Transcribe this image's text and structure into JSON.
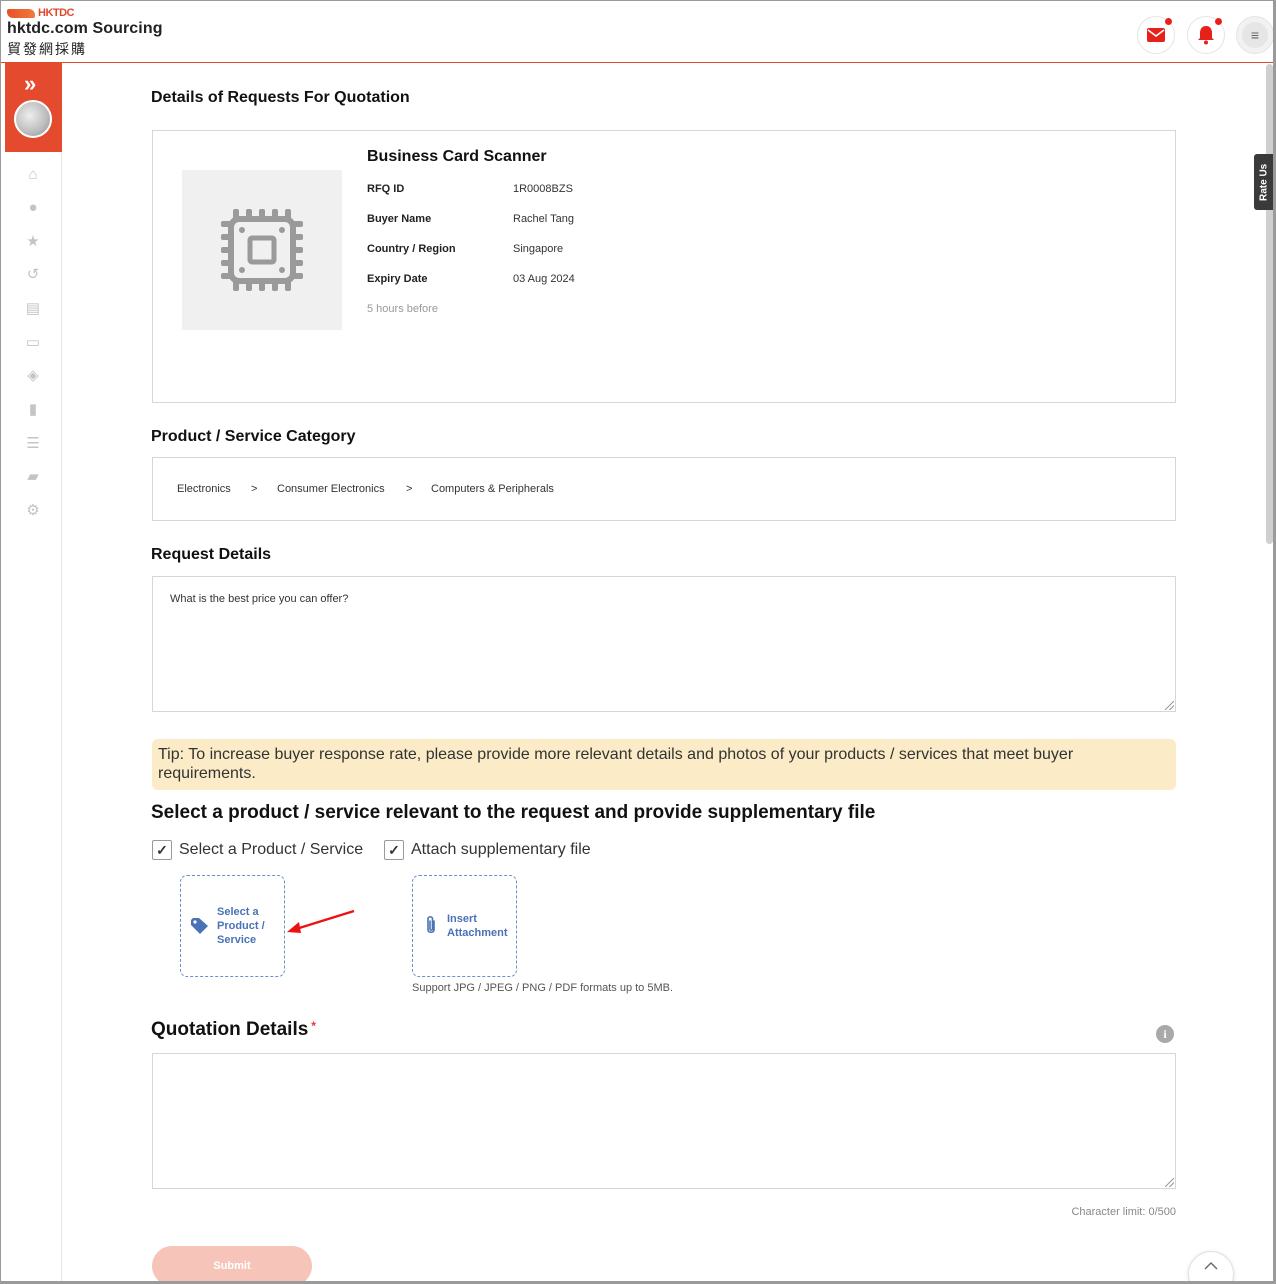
{
  "brand": {
    "small": "HKTDC",
    "main": "hktdc.com Sourcing",
    "zh": "貿發網採購",
    "accent": "#e44a2e"
  },
  "header": {
    "icons": [
      "mail-icon",
      "bell-icon",
      "menu-icon"
    ]
  },
  "sidebar": {
    "expand_glyph": "»",
    "items": [
      {
        "name": "home-icon",
        "glyph": "⌂"
      },
      {
        "name": "user-icon",
        "glyph": "●"
      },
      {
        "name": "star-icon",
        "glyph": "★"
      },
      {
        "name": "history-icon",
        "glyph": "↺"
      },
      {
        "name": "chat-icon",
        "glyph": "▤"
      },
      {
        "name": "id-card-icon",
        "glyph": "▭"
      },
      {
        "name": "box-icon",
        "glyph": "◈"
      },
      {
        "name": "bag-icon",
        "glyph": "▮"
      },
      {
        "name": "list-icon",
        "glyph": "☰"
      },
      {
        "name": "truck-icon",
        "glyph": "▰"
      },
      {
        "name": "user-settings-icon",
        "glyph": "⚙"
      }
    ]
  },
  "rate_us": "Rate Us",
  "page_title": "Details of Requests For Quotation",
  "rfq": {
    "product_name": "Business Card Scanner",
    "fields": [
      {
        "label": "RFQ ID",
        "value": "1R0008BZS"
      },
      {
        "label": "Buyer Name",
        "value": "Rachel Tang"
      },
      {
        "label": "Country / Region",
        "value": "Singapore"
      },
      {
        "label": "Expiry Date",
        "value": "03 Aug 2024"
      }
    ],
    "posted": "5 hours before"
  },
  "category": {
    "title": "Product / Service Category",
    "path": [
      "Electronics",
      ">",
      "Consumer Electronics",
      ">",
      "Computers & Peripherals"
    ]
  },
  "request": {
    "title": "Request Details",
    "text": "What is the best price you can offer?"
  },
  "tip": "Tip: To increase buyer response rate, please provide more relevant details and photos of your products / services that meet buyer requirements.",
  "supplement": {
    "title": "Select a product / service relevant to the request and provide supplementary file",
    "check_product": "Select a Product / Service",
    "check_attach": "Attach supplementary file",
    "select_line1": "Select a",
    "select_line2": "Product /",
    "select_line3": "Service",
    "attach_line1": "Insert",
    "attach_line2": "Attachment",
    "support": "Support JPG / JPEG / PNG / PDF formats up to 5MB."
  },
  "quotation": {
    "title": "Quotation Details",
    "required_mark": "*",
    "info_glyph": "i",
    "char_limit": "Character limit: 0/500",
    "submit": "Submit"
  }
}
